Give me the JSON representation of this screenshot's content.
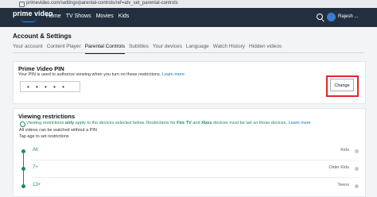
{
  "browser": {
    "url": "primevideo.com/settings/parental-controls/ref=atv_set_parental-controls"
  },
  "nav": {
    "logo_text": "prime video",
    "links": [
      "Home",
      "TV Shows",
      "Movies",
      "Kids"
    ],
    "user": "Rajesh ..."
  },
  "page": {
    "title": "Account & Settings"
  },
  "tabs": [
    "Your account",
    "Content Player",
    "Parental Controls",
    "Subtitles",
    "Your devices",
    "Language",
    "Watch History",
    "Hidden videos"
  ],
  "active_tab": "Parental Controls",
  "pin": {
    "title": "Prime Video PIN",
    "desc": "Your PIN is used to authorize viewing when you turn on these restrictions.",
    "learn_more": "Learn more",
    "value": "• • • • •",
    "change_label": "Change"
  },
  "restrictions": {
    "title": "Viewing restrictions",
    "info_prefix": "Viewing restrictions ",
    "info_only": "only",
    "info_middle": " apply to the devices selected below. Restrictions for ",
    "info_firetv": "Fire TV",
    "info_and": " and ",
    "info_xbox": "Xbox",
    "info_suffix": " devices must be set on those devices.",
    "learn_more": "Learn more",
    "note1": "All videos can be watched without a PIN",
    "note2": "Tap age to set restrictions",
    "levels": [
      {
        "age": "All",
        "category": "Kids"
      },
      {
        "age": "7+",
        "category": "Older Kids"
      },
      {
        "age": "13+",
        "category": "Teens"
      }
    ]
  },
  "colors": {
    "nav_bg": "#232f3e",
    "accent_green": "#1e8b5c",
    "highlight_red": "#e3262a",
    "link_blue": "#0a77b5"
  }
}
